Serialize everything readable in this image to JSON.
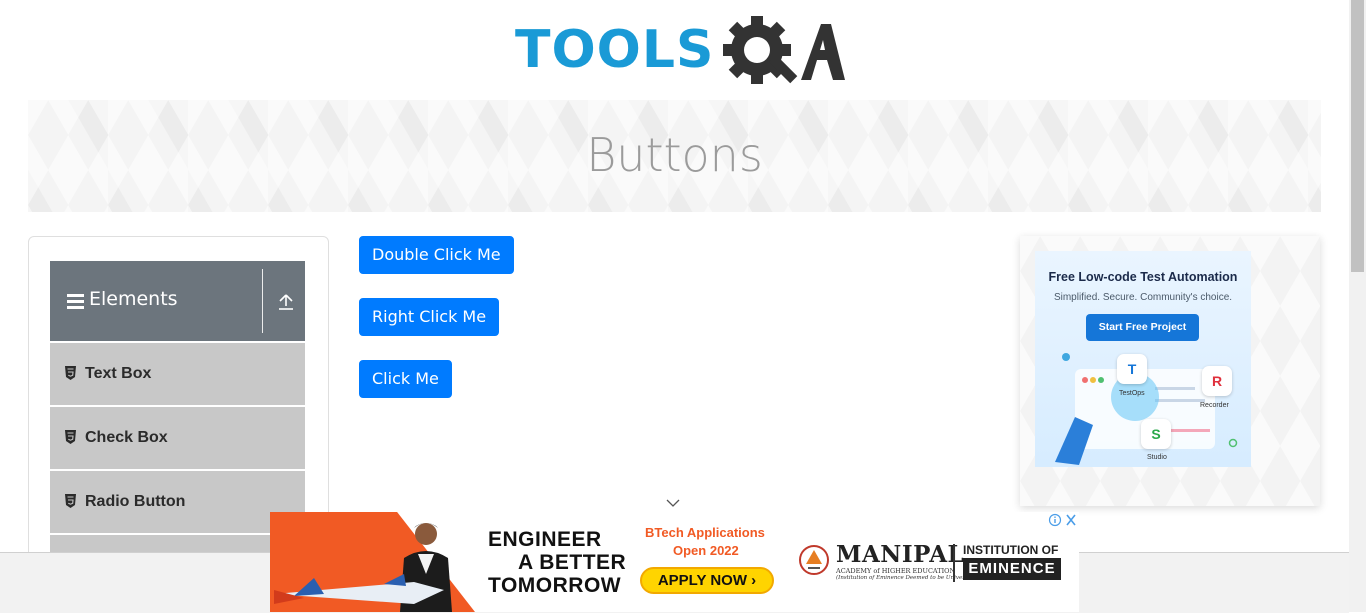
{
  "header": {
    "logo_text": "TOOLS",
    "logo_suffix": "QA"
  },
  "banner": {
    "title": "Buttons"
  },
  "sidebar": {
    "group_label": "Elements",
    "items": [
      {
        "label": "Text Box"
      },
      {
        "label": "Check Box"
      },
      {
        "label": "Radio Button"
      }
    ]
  },
  "buttons": {
    "double_click": "Double Click Me",
    "right_click": "Right Click Me",
    "click": "Click Me"
  },
  "right_ad": {
    "title": "Free Low-code Test Automation",
    "subtitle": "Simplified. Secure. Community's choice.",
    "cta": "Start Free Project",
    "tiles": [
      {
        "letter": "T",
        "caption": "TestOps"
      },
      {
        "letter": "R",
        "caption": "Recorder"
      },
      {
        "letter": "S",
        "caption": "Studio"
      }
    ]
  },
  "bottom_ad": {
    "headline_1": "ENGINEER",
    "headline_2": "A BETTER",
    "headline_3": "TOMORROW",
    "btech_1": "BTech Applications",
    "btech_2": "Open 2022",
    "apply": "APPLY NOW",
    "brand": "MANIPAL",
    "brand_sub": "ACADEMY of HIGHER EDUCATION",
    "brand_tagline": "(Institution of Eminence Deemed to be University)",
    "institution": "INSTITUTION OF",
    "eminence": "EMINENCE"
  },
  "colors": {
    "primary": "#007bff",
    "sidebar_header": "#6c757d",
    "sidebar_item": "#c8c8c8",
    "logo_blue": "#1a9ad6",
    "logo_dark": "#333333",
    "ad_orange": "#f15a24"
  }
}
